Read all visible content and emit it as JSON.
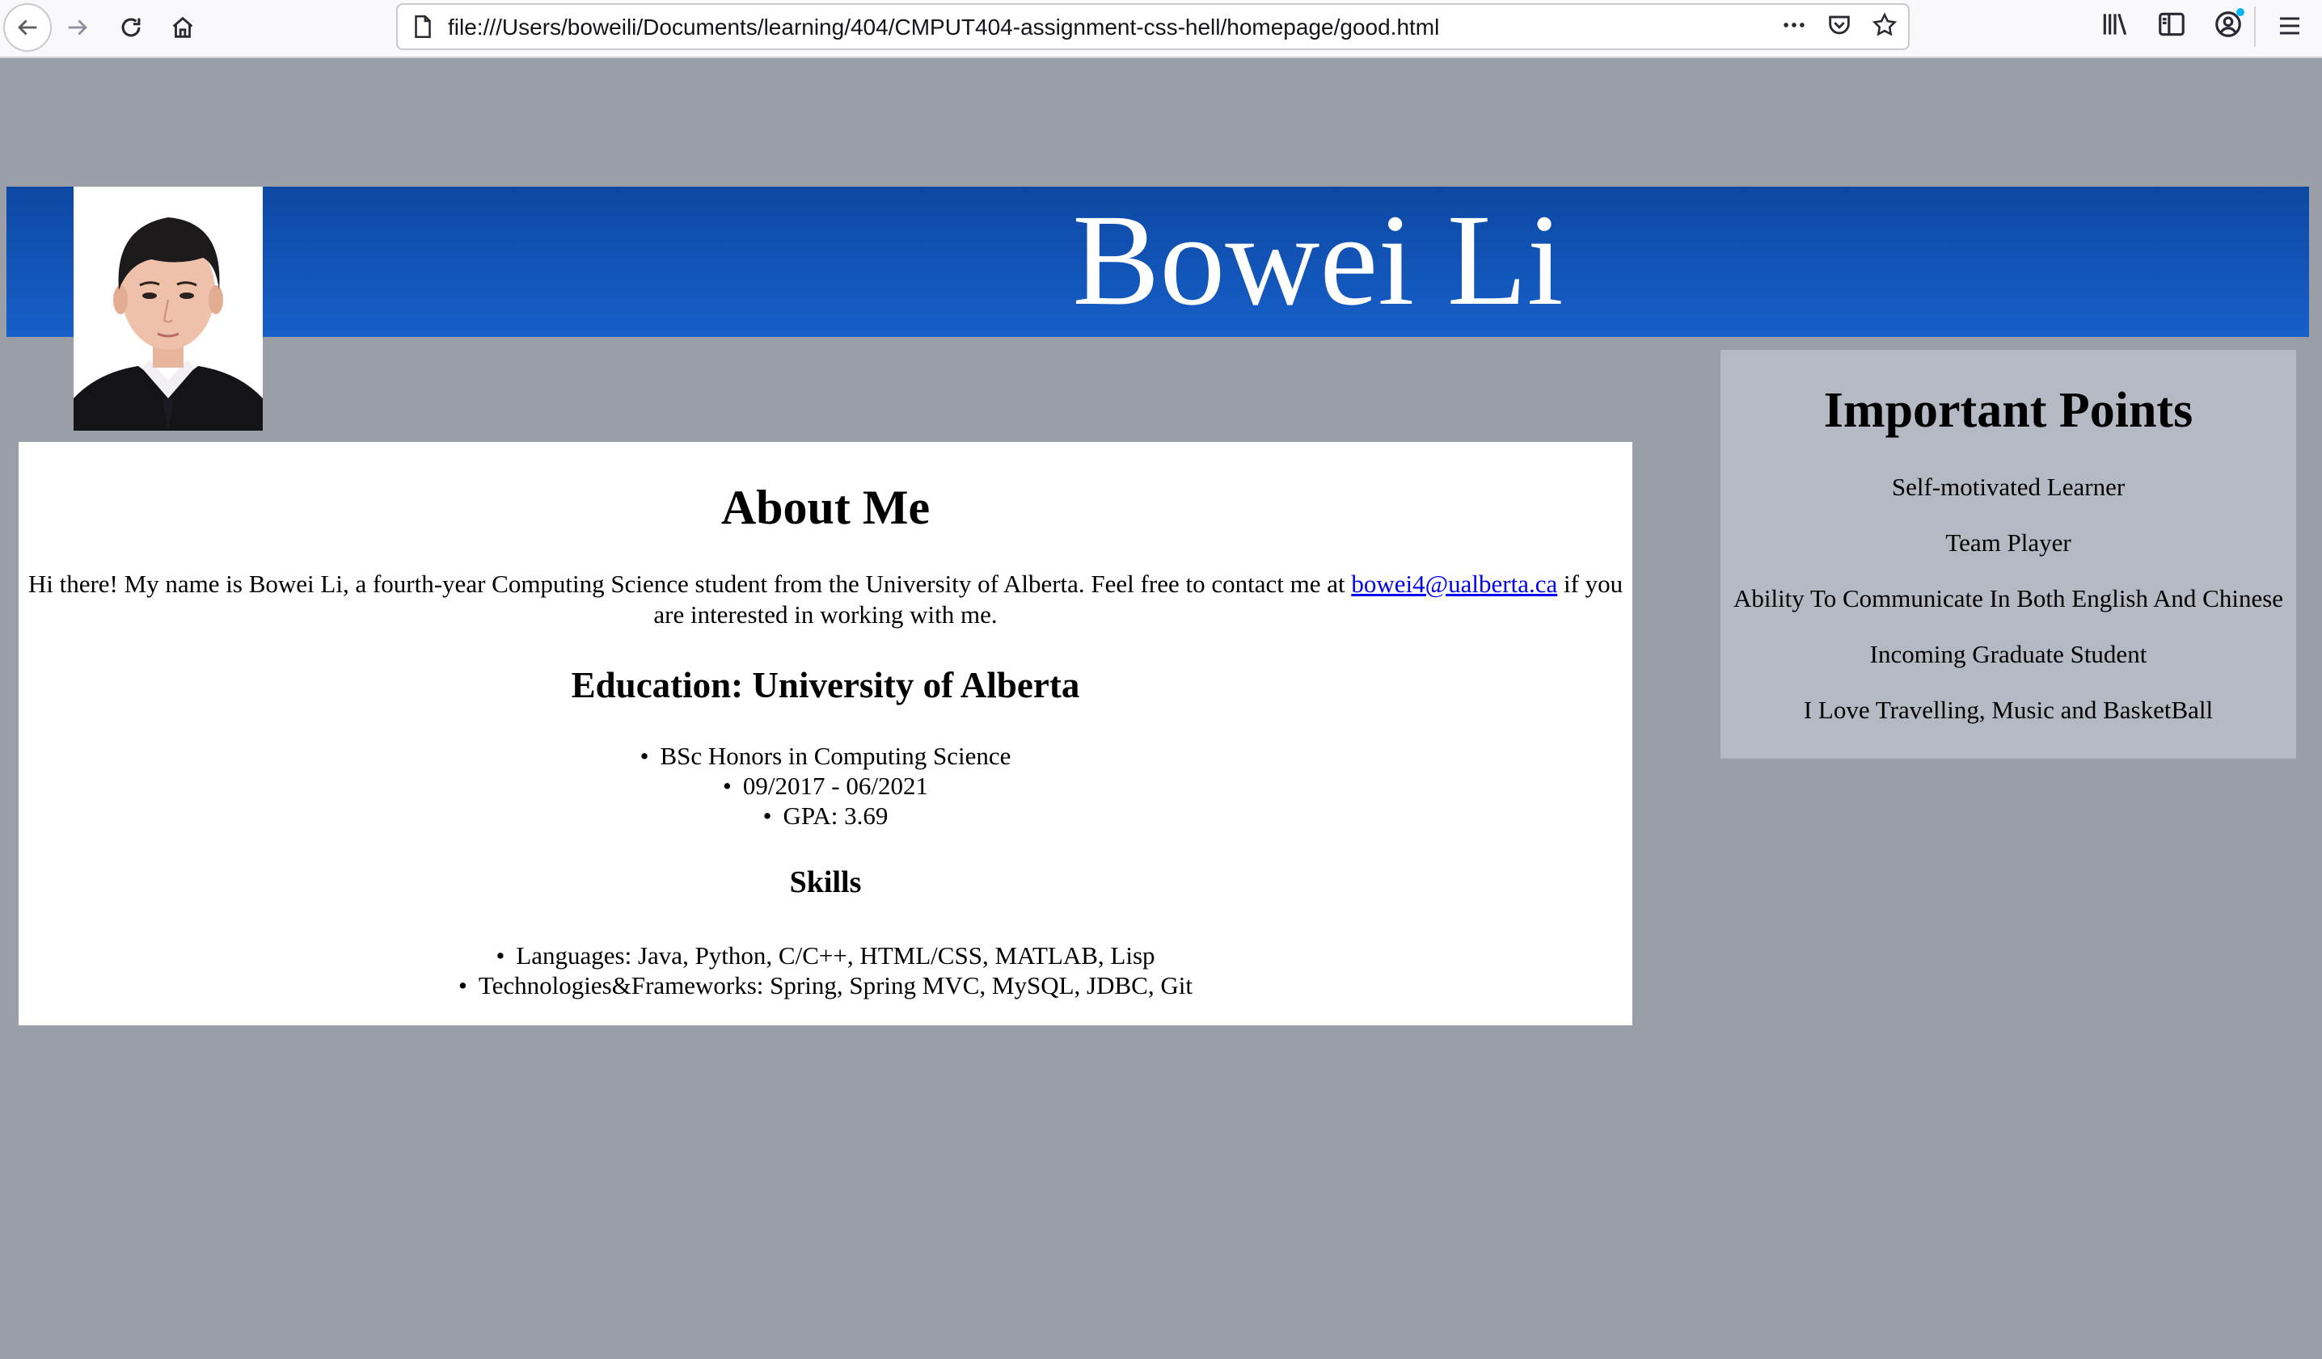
{
  "browser": {
    "url": "file:///Users/boweili/Documents/learning/404/CMPUT404-assignment-css-hell/homepage/good.html"
  },
  "header": {
    "name": "Bowei Li"
  },
  "about": {
    "title": "About Me",
    "intro_before": "Hi there! My name is Bowei Li, a fourth-year Computing Science student from the University of Alberta. Feel free to contact me at ",
    "email": "bowei4@ualberta.ca",
    "intro_after": " if you are interested in working with me.",
    "education_title": "Education: University of Alberta",
    "education": [
      "BSc Honors in Computing Science",
      "09/2017 - 06/2021",
      "GPA: 3.69"
    ],
    "skills_title": "Skills",
    "skills": [
      "Languages: Java, Python, C/C++, HTML/CSS, MATLAB, Lisp",
      "Technologies&Frameworks: Spring, Spring MVC, MySQL, JDBC, Git"
    ]
  },
  "points": {
    "title": "Important Points",
    "items": [
      "Self-motivated Learner",
      "Team Player",
      "Ability To Communicate In Both English And Chinese",
      "Incoming Graduate Student",
      "I Love Travelling, Music and BasketBall"
    ]
  },
  "colors": {
    "page_bg": "#9a9ea7",
    "banner": "#1152b8",
    "sidebar_bg": "#b5b9c4",
    "link": "#0000ee"
  }
}
